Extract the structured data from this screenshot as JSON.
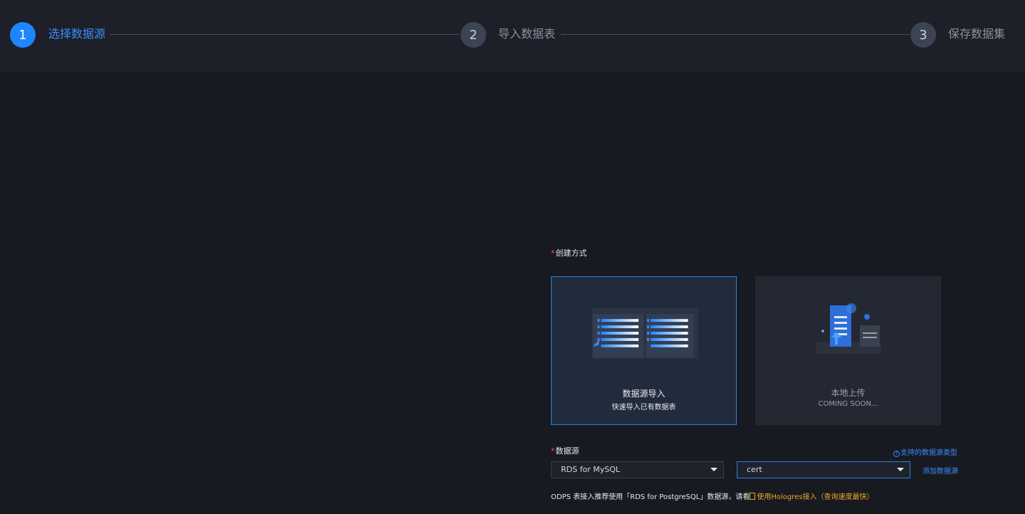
{
  "stepper": {
    "steps": [
      {
        "number": "1",
        "label": "选择数据源"
      },
      {
        "number": "2",
        "label": "导入数据表"
      },
      {
        "number": "3",
        "label": "保存数据集"
      }
    ],
    "active_step": 1
  },
  "form": {
    "create_method": {
      "required_mark": "*",
      "label": "创建方式",
      "options": [
        {
          "title": "数据源导入",
          "subtitle": "快速导入已有数据表",
          "selected": true
        },
        {
          "title": "本地上传",
          "subtitle": "COMING SOON...",
          "selected": false
        }
      ]
    },
    "datasource": {
      "required_mark": "*",
      "label": "数据源",
      "help_link": "支持的数据源类型",
      "type_select": "RDS for MySQL",
      "instance_select": "cert",
      "add_link": "添加数据源"
    },
    "note": {
      "text": "ODPS 表接入推荐使用「RDS for PostgreSQL」数据源，请看",
      "link": "使用Hologres接入（查询速度最快）"
    }
  },
  "colors": {
    "accent": "#1f86ff",
    "warning": "#f5a623",
    "required": "#ff4d4f"
  }
}
